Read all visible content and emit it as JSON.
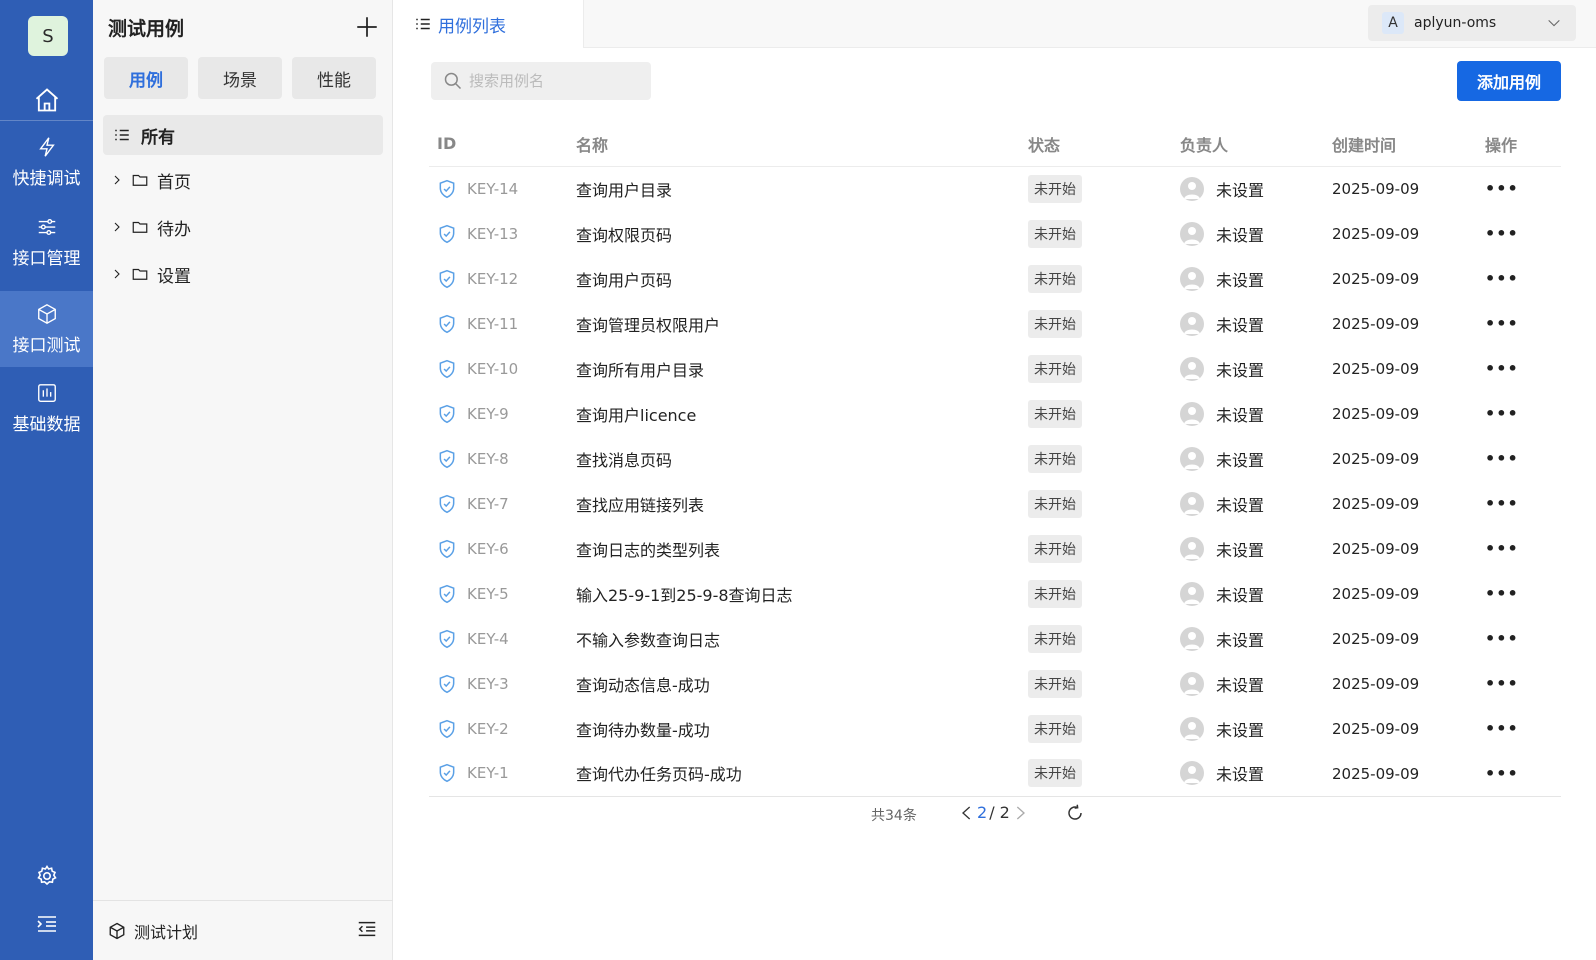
{
  "rail": {
    "avatar_letter": "S",
    "items": [
      {
        "label": "快捷调试",
        "icon": "lightning-icon"
      },
      {
        "label": "接口管理",
        "icon": "sliders-icon"
      },
      {
        "label": "接口测试",
        "icon": "cube-icon"
      },
      {
        "label": "基础数据",
        "icon": "chart-icon"
      }
    ],
    "active_index": 2
  },
  "panel": {
    "title": "测试用例",
    "segments": [
      "用例",
      "场景",
      "性能"
    ],
    "active_segment": 0,
    "all_label": "所有",
    "tree": [
      "首页",
      "待办",
      "设置"
    ],
    "footer_label": "测试计划"
  },
  "main": {
    "tab_label": "用例列表",
    "project": {
      "letter": "A",
      "name": "aplyun-oms"
    },
    "search_placeholder": "搜索用例名",
    "add_button": "添加用例",
    "columns": [
      "ID",
      "名称",
      "状态",
      "负责人",
      "创建时间",
      "操作"
    ],
    "rows": [
      {
        "id": "KEY-14",
        "name": "查询用户目录",
        "status": "未开始",
        "owner": "未设置",
        "date": "2025-09-09"
      },
      {
        "id": "KEY-13",
        "name": "查询权限页码",
        "status": "未开始",
        "owner": "未设置",
        "date": "2025-09-09"
      },
      {
        "id": "KEY-12",
        "name": "查询用户页码",
        "status": "未开始",
        "owner": "未设置",
        "date": "2025-09-09"
      },
      {
        "id": "KEY-11",
        "name": "查询管理员权限用户",
        "status": "未开始",
        "owner": "未设置",
        "date": "2025-09-09"
      },
      {
        "id": "KEY-10",
        "name": "查询所有用户目录",
        "status": "未开始",
        "owner": "未设置",
        "date": "2025-09-09"
      },
      {
        "id": "KEY-9",
        "name": "查询用户licence",
        "status": "未开始",
        "owner": "未设置",
        "date": "2025-09-09"
      },
      {
        "id": "KEY-8",
        "name": "查找消息页码",
        "status": "未开始",
        "owner": "未设置",
        "date": "2025-09-09"
      },
      {
        "id": "KEY-7",
        "name": "查找应用链接列表",
        "status": "未开始",
        "owner": "未设置",
        "date": "2025-09-09"
      },
      {
        "id": "KEY-6",
        "name": "查询日志的类型列表",
        "status": "未开始",
        "owner": "未设置",
        "date": "2025-09-09"
      },
      {
        "id": "KEY-5",
        "name": "输入25-9-1到25-9-8查询日志",
        "status": "未开始",
        "owner": "未设置",
        "date": "2025-09-09"
      },
      {
        "id": "KEY-4",
        "name": "不输入参数查询日志",
        "status": "未开始",
        "owner": "未设置",
        "date": "2025-09-09"
      },
      {
        "id": "KEY-3",
        "name": "查询动态信息-成功",
        "status": "未开始",
        "owner": "未设置",
        "date": "2025-09-09"
      },
      {
        "id": "KEY-2",
        "name": "查询待办数量-成功",
        "status": "未开始",
        "owner": "未设置",
        "date": "2025-09-09"
      },
      {
        "id": "KEY-1",
        "name": "查询代办任务页码-成功",
        "status": "未开始",
        "owner": "未设置",
        "date": "2025-09-09"
      }
    ],
    "more_label": "•••",
    "pager": {
      "total": "共34条",
      "current": "2",
      "total_pages": "/ 2"
    }
  },
  "colors": {
    "rail": "#2f5eb5",
    "accent": "#1668e3",
    "link": "#2f6fdc"
  }
}
